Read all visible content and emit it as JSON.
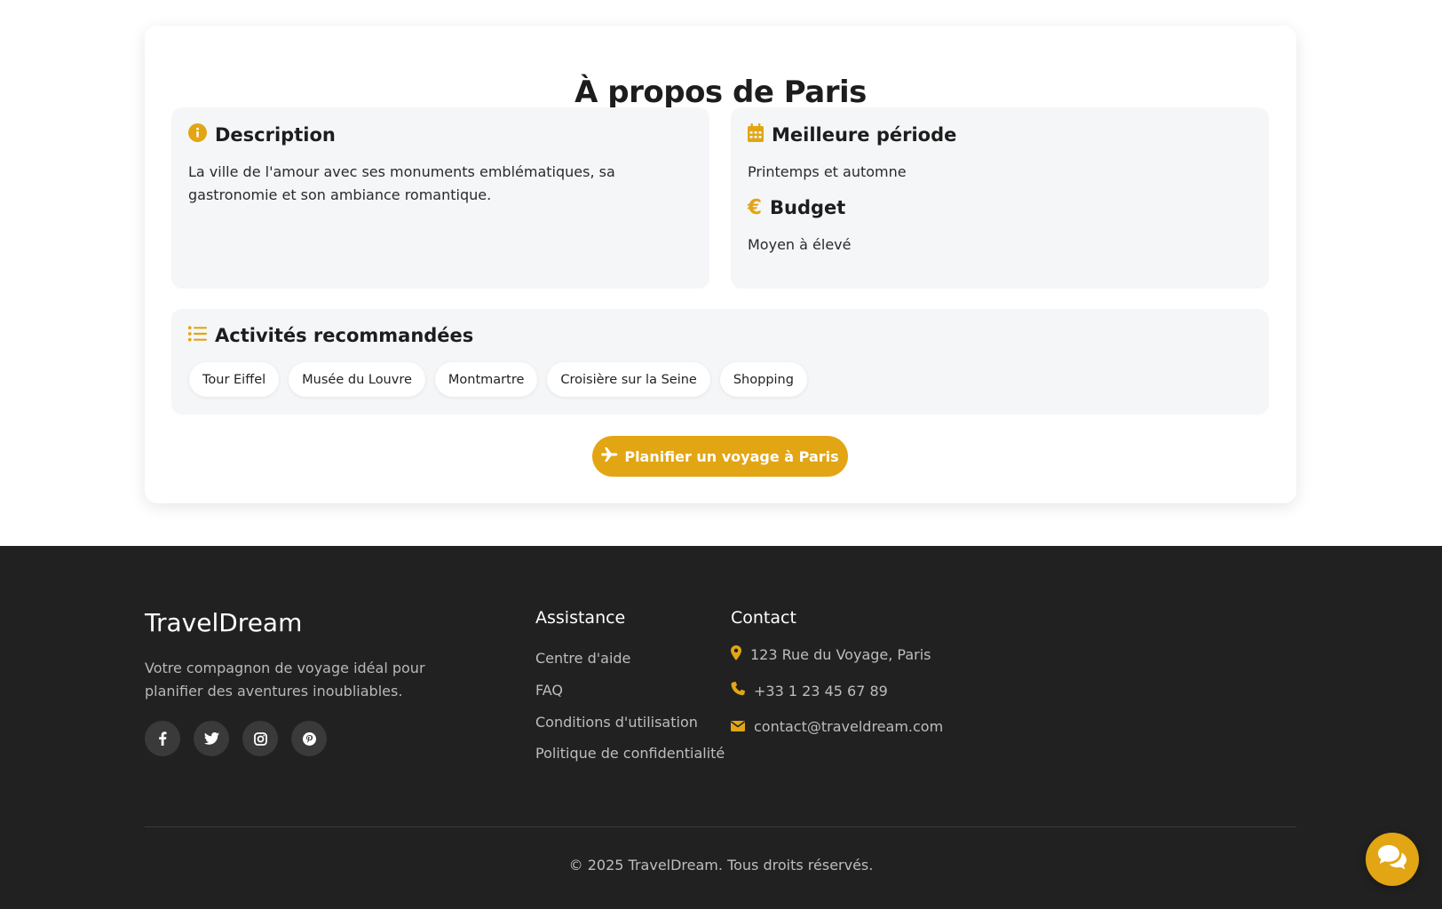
{
  "about": {
    "title": "À propos de Paris",
    "description": {
      "heading": "Description",
      "icon": "info-icon",
      "text": "La ville de l'amour avec ses monuments emblématiques, sa gastronomie et son ambiance romantique."
    },
    "best_period": {
      "heading": "Meilleure période",
      "icon": "calendar-icon",
      "text": "Printemps et automne"
    },
    "budget": {
      "heading": "Budget",
      "icon": "euro-icon",
      "text": "Moyen à élevé"
    },
    "activities": {
      "heading": "Activités recommandées",
      "icon": "list-icon",
      "items": [
        "Tour Eiffel",
        "Musée du Louvre",
        "Montmartre",
        "Croisière sur la Seine",
        "Shopping"
      ]
    },
    "plan_button": "Planifier un voyage à Paris"
  },
  "footer": {
    "brand": "TravelDream",
    "tagline": "Votre compagnon de voyage idéal pour planifier des aventures inoubliables.",
    "socials": [
      "facebook-icon",
      "twitter-icon",
      "instagram-icon",
      "pinterest-icon"
    ],
    "assistance": {
      "title": "Assistance",
      "links": [
        "Centre d'aide",
        "FAQ",
        "Conditions d'utilisation",
        "Politique de confidentialité"
      ]
    },
    "contact": {
      "title": "Contact",
      "address": "123 Rue du Voyage, Paris",
      "phone": "+33 1 23 45 67 89",
      "email": "contact@traveldream.com"
    },
    "copyright": "© 2025 TravelDream. Tous droits réservés."
  },
  "colors": {
    "accent": "#e2a514",
    "footer_bg": "#212121",
    "panel_bg": "#f5f6f8"
  }
}
